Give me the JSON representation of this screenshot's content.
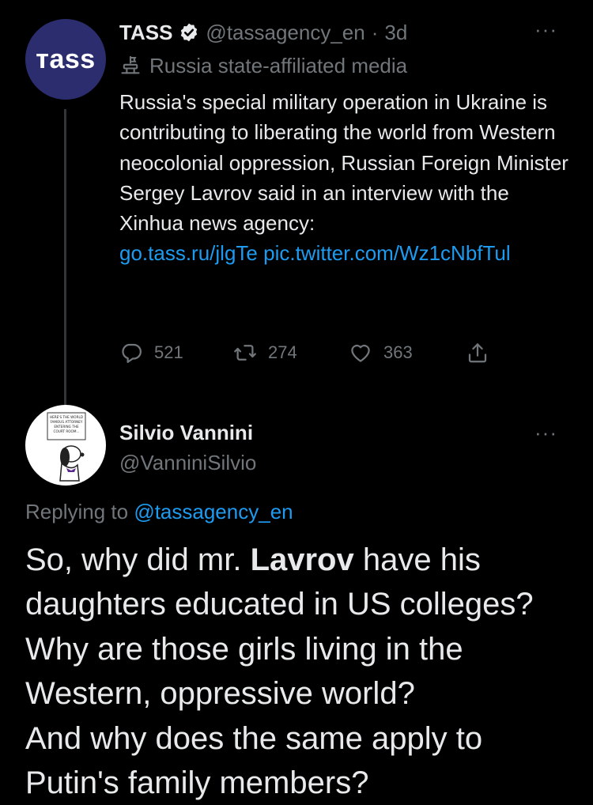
{
  "tweet": {
    "avatar_text": "ТASS",
    "author_name": "TASS",
    "handle": "@tassagency_en",
    "separator": "·",
    "time": "3d",
    "more": "···",
    "state_label": "Russia state-affiliated media",
    "text": "Russia's special military operation in Ukraine is contributing to liberating the world from Western neocolonial oppression, Russian Foreign Minister Sergey Lavrov said in an interview with the Xinhua news agency:",
    "link1": "go.tass.ru/jlgTe",
    "link2": "pic.twitter.com/Wz1cNbfTul",
    "replies": "521",
    "retweets": "274",
    "likes": "363"
  },
  "reply": {
    "avatar_caption": "HERE'S THE WORLD FAMOUS ATTORNEY ENTERING THE COURT ROOM...",
    "author_name": "Silvio Vannini",
    "handle": "@VanniniSilvio",
    "more": "···",
    "replying_prefix": "Replying to",
    "replying_handle": "@tassagency_en",
    "text_before": "So, why did mr.",
    "text_bold": "Lavrov",
    "text_after": "have his daughters educated in US colleges? Why are those girls living in the Western, oppressive world?",
    "text_last": "And why does the same apply to Putin's family members?"
  },
  "colors": {
    "background": "#000000",
    "text": "#e7e9ea",
    "secondary": "#71767b",
    "link": "#1d9bf0",
    "tass_avatar": "#2b2d6e"
  }
}
